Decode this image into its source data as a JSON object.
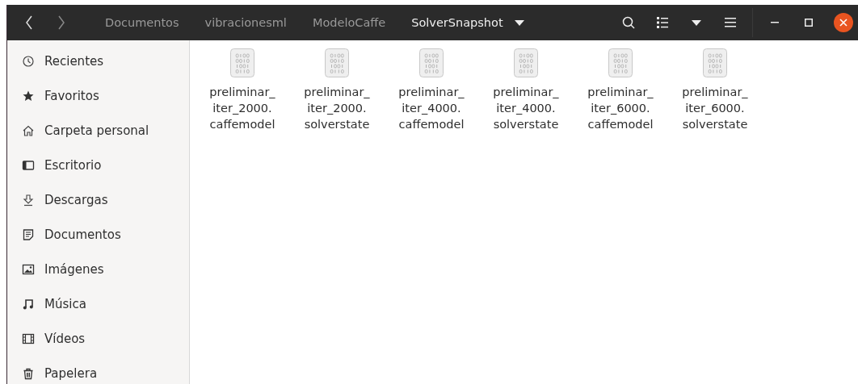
{
  "header": {
    "breadcrumbs": [
      {
        "label": "Documentos",
        "selected": false
      },
      {
        "label": "vibracionesml",
        "selected": false
      },
      {
        "label": "ModeloCaffe",
        "selected": false
      },
      {
        "label": "SolverSnapshot",
        "selected": true
      }
    ]
  },
  "sidebar": {
    "items": [
      {
        "label": "Recientes"
      },
      {
        "label": "Favoritos"
      },
      {
        "label": "Carpeta personal"
      },
      {
        "label": "Escritorio"
      },
      {
        "label": "Descargas"
      },
      {
        "label": "Documentos"
      },
      {
        "label": "Imágenes"
      },
      {
        "label": "Música"
      },
      {
        "label": "Vídeos"
      },
      {
        "label": "Papelera"
      }
    ]
  },
  "files": [
    {
      "name_lines": [
        "preliminar_",
        "iter_2000.",
        "caffemodel"
      ]
    },
    {
      "name_lines": [
        "preliminar_",
        "iter_2000.",
        "solverstate"
      ]
    },
    {
      "name_lines": [
        "preliminar_",
        "iter_4000.",
        "caffemodel"
      ]
    },
    {
      "name_lines": [
        "preliminar_",
        "iter_4000.",
        "solverstate"
      ]
    },
    {
      "name_lines": [
        "preliminar_",
        "iter_6000.",
        "caffemodel"
      ]
    },
    {
      "name_lines": [
        "preliminar_",
        "iter_6000.",
        "solverstate"
      ]
    }
  ]
}
